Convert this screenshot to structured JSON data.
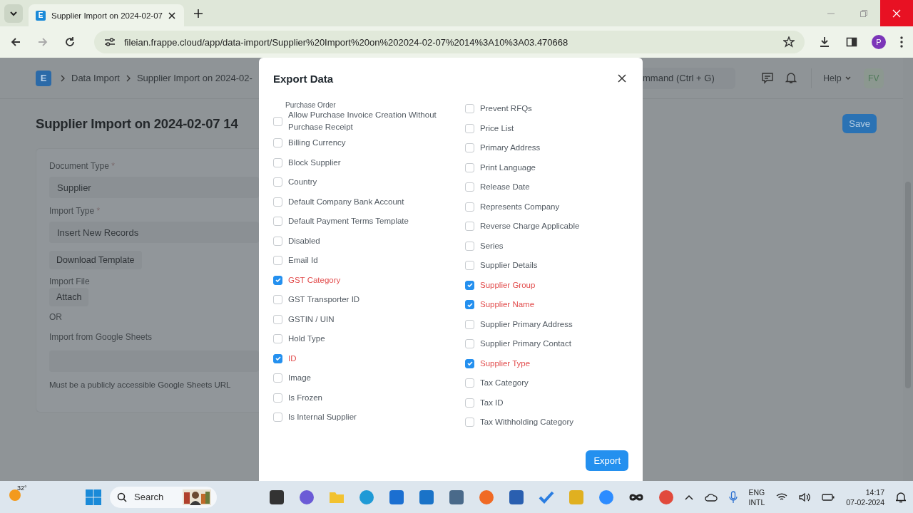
{
  "browser": {
    "tab_favicon": "E",
    "tab_title": "Supplier Import on 2024-02-07",
    "url": "fileian.frappe.cloud/app/data-import/Supplier%20Import%20on%202024-02-07%2014%3A10%3A03.470668",
    "profile": "P"
  },
  "navbar": {
    "logo": "E",
    "breadcrumbs": [
      "Data Import",
      "Supplier Import on 2024-02-"
    ],
    "search_placeholder": "mmand (Ctrl + G)",
    "help": "Help",
    "avatar": "FV"
  },
  "page": {
    "title": "Supplier Import on 2024-02-07 14",
    "save": "Save",
    "form": {
      "document_type": {
        "label": "Document Type",
        "required_mark": "*",
        "value": "Supplier"
      },
      "import_type": {
        "label": "Import Type",
        "required_mark": "*",
        "value": "Insert New Records"
      },
      "download_template": "Download Template",
      "import_file": {
        "label": "Import File",
        "button": "Attach"
      },
      "or": "OR",
      "google_sheets": {
        "label": "Import from Google Sheets",
        "help": "Must be a publicly accessible Google Sheets URL"
      }
    }
  },
  "dialog": {
    "title": "Export Data",
    "export": "Export",
    "columns": [
      [
        {
          "label": "Purchase Order",
          "kind": "cut"
        },
        {
          "label": "Allow Purchase Invoice Creation Without Purchase Receipt",
          "checked": false
        },
        {
          "label": "Billing Currency",
          "checked": false
        },
        {
          "label": "Block Supplier",
          "checked": false
        },
        {
          "label": "Country",
          "checked": false
        },
        {
          "label": "Default Company Bank Account",
          "checked": false
        },
        {
          "label": "Default Payment Terms Template",
          "checked": false
        },
        {
          "label": "Disabled",
          "checked": false
        },
        {
          "label": "Email Id",
          "checked": false
        },
        {
          "label": "GST Category",
          "checked": true
        },
        {
          "label": "GST Transporter ID",
          "checked": false
        },
        {
          "label": "GSTIN / UIN",
          "checked": false
        },
        {
          "label": "Hold Type",
          "checked": false
        },
        {
          "label": "ID",
          "checked": true
        },
        {
          "label": "Image",
          "checked": false
        },
        {
          "label": "Is Frozen",
          "checked": false
        },
        {
          "label": "Is Internal Supplier",
          "checked": false
        }
      ],
      [
        {
          "label": "Prevent RFQs",
          "checked": false
        },
        {
          "label": "Price List",
          "checked": false
        },
        {
          "label": "Primary Address",
          "checked": false
        },
        {
          "label": "Print Language",
          "checked": false
        },
        {
          "label": "Release Date",
          "checked": false
        },
        {
          "label": "Represents Company",
          "checked": false
        },
        {
          "label": "Reverse Charge Applicable",
          "checked": false
        },
        {
          "label": "Series",
          "checked": false
        },
        {
          "label": "Supplier Details",
          "checked": false
        },
        {
          "label": "Supplier Group",
          "checked": true
        },
        {
          "label": "Supplier Name",
          "checked": true
        },
        {
          "label": "Supplier Primary Address",
          "checked": false
        },
        {
          "label": "Supplier Primary Contact",
          "checked": false
        },
        {
          "label": "Supplier Type",
          "checked": true
        },
        {
          "label": "Tax Category",
          "checked": false
        },
        {
          "label": "Tax ID",
          "checked": false
        },
        {
          "label": "Tax Withholding Category",
          "checked": false
        }
      ]
    ]
  },
  "taskbar": {
    "weather": "32°",
    "search_placeholder": "Search",
    "language": [
      "ENG",
      "INTL"
    ],
    "time": "14:17",
    "date": "07-02-2024"
  }
}
